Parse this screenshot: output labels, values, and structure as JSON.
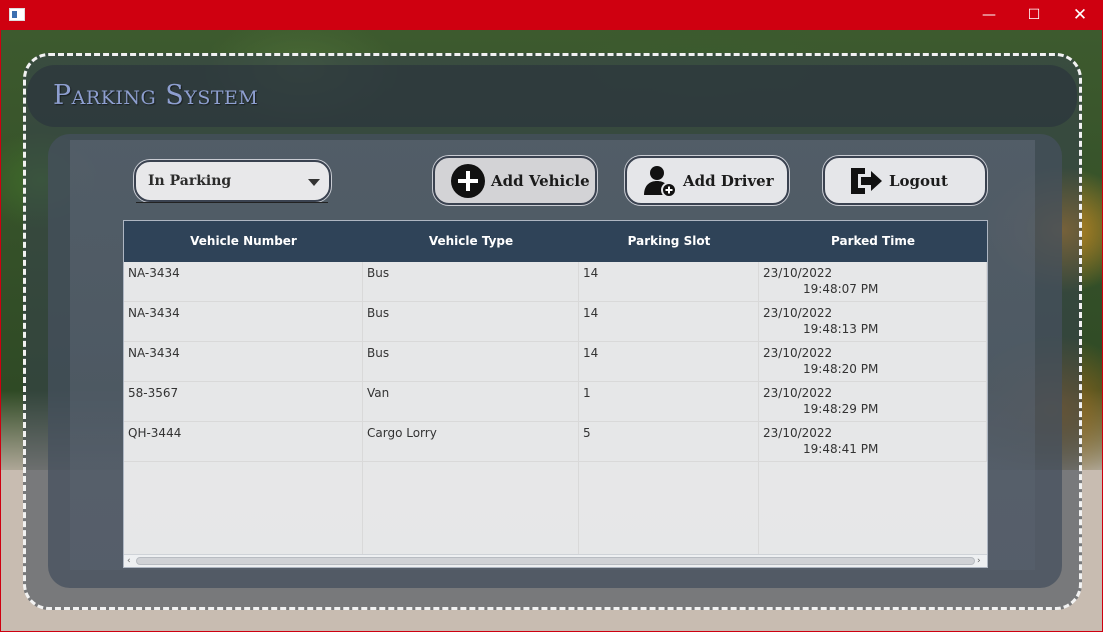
{
  "window": {
    "minimize_glyph": "—",
    "maximize_glyph": "☐",
    "close_glyph": "✕"
  },
  "header": {
    "title": "Parking System"
  },
  "toolbar": {
    "status_select": {
      "value": "In Parking",
      "icon": "chevron-down-icon"
    },
    "add_vehicle": {
      "label": "Add Vehicle",
      "icon": "plus-circle-icon"
    },
    "add_driver": {
      "label": "Add Driver",
      "icon": "add-user-icon"
    },
    "logout": {
      "label": "Logout",
      "icon": "logout-icon"
    }
  },
  "table": {
    "columns": [
      "Vehicle Number",
      "Vehicle Type",
      "Parking Slot",
      "Parked Time"
    ],
    "rows": [
      {
        "vehicle_number": "NA-3434",
        "vehicle_type": "Bus",
        "parking_slot": "14",
        "parked_date": "23/10/2022",
        "parked_time": "19:48:07 PM"
      },
      {
        "vehicle_number": "NA-3434",
        "vehicle_type": "Bus",
        "parking_slot": "14",
        "parked_date": "23/10/2022",
        "parked_time": "19:48:13 PM"
      },
      {
        "vehicle_number": "NA-3434",
        "vehicle_type": "Bus",
        "parking_slot": "14",
        "parked_date": "23/10/2022",
        "parked_time": "19:48:20 PM"
      },
      {
        "vehicle_number": "58-3567",
        "vehicle_type": "Van",
        "parking_slot": "1",
        "parked_date": "23/10/2022",
        "parked_time": "19:48:29 PM"
      },
      {
        "vehicle_number": "QH-3444",
        "vehicle_type": "Cargo Lorry",
        "parking_slot": "5",
        "parked_date": "23/10/2022",
        "parked_time": "19:48:41 PM"
      }
    ]
  },
  "colors": {
    "titlebar": "#cf0010",
    "table_header": "#2f4358",
    "title_text": "#8e9fd0"
  }
}
